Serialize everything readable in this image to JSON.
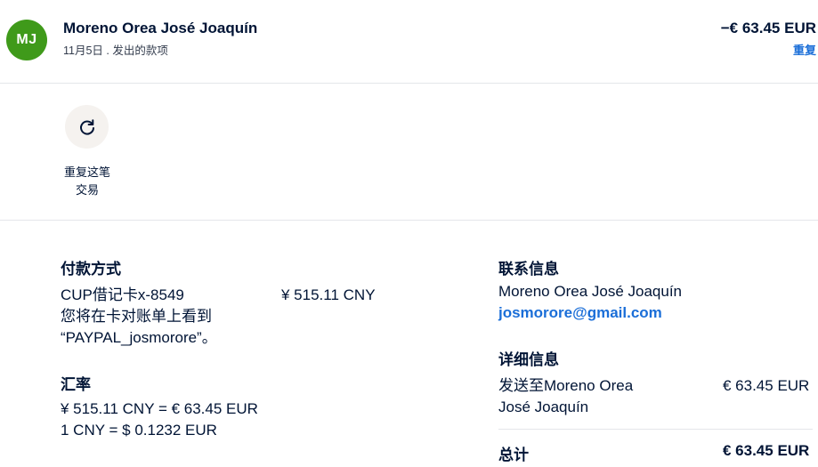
{
  "header": {
    "avatar_initials": "MJ",
    "avatar_color": "#3f9a1a",
    "merchant_name": "Moreno Orea José Joaquín",
    "subtitle": "11月5日 . 发出的款项",
    "amount": "−€ 63.45 EUR",
    "repeat_link": "重复"
  },
  "repeat_action": {
    "icon": "refresh-icon",
    "label_line1": "重复这笔",
    "label_line2": "交易"
  },
  "payment_method": {
    "heading": "付款方式",
    "card": "CUP借记卡x-8549",
    "amount": "¥ 515.11 CNY",
    "statement_line1": "您将在卡对账单上看到",
    "statement_line2": "“PAYPAL_josmorore”。"
  },
  "exchange_rate": {
    "heading": "汇率",
    "line1": "¥ 515.11 CNY = € 63.45 EUR",
    "line2": "1 CNY = $ 0.1232 EUR"
  },
  "contact": {
    "heading": "联系信息",
    "name": "Moreno Orea José Joaquín",
    "email": "josmorore@gmail.com"
  },
  "details": {
    "heading": "详细信息",
    "sent_to_line1": "发送至Moreno Orea",
    "sent_to_line2": "José Joaquín",
    "amount": "€ 63.45 EUR"
  },
  "total": {
    "label": "总计",
    "amount": "€ 63.45 EUR"
  },
  "colors": {
    "text": "#001435",
    "link": "#1a6ed8",
    "divider": "#e4e6ea",
    "icon_bg": "#f5f2ef"
  }
}
